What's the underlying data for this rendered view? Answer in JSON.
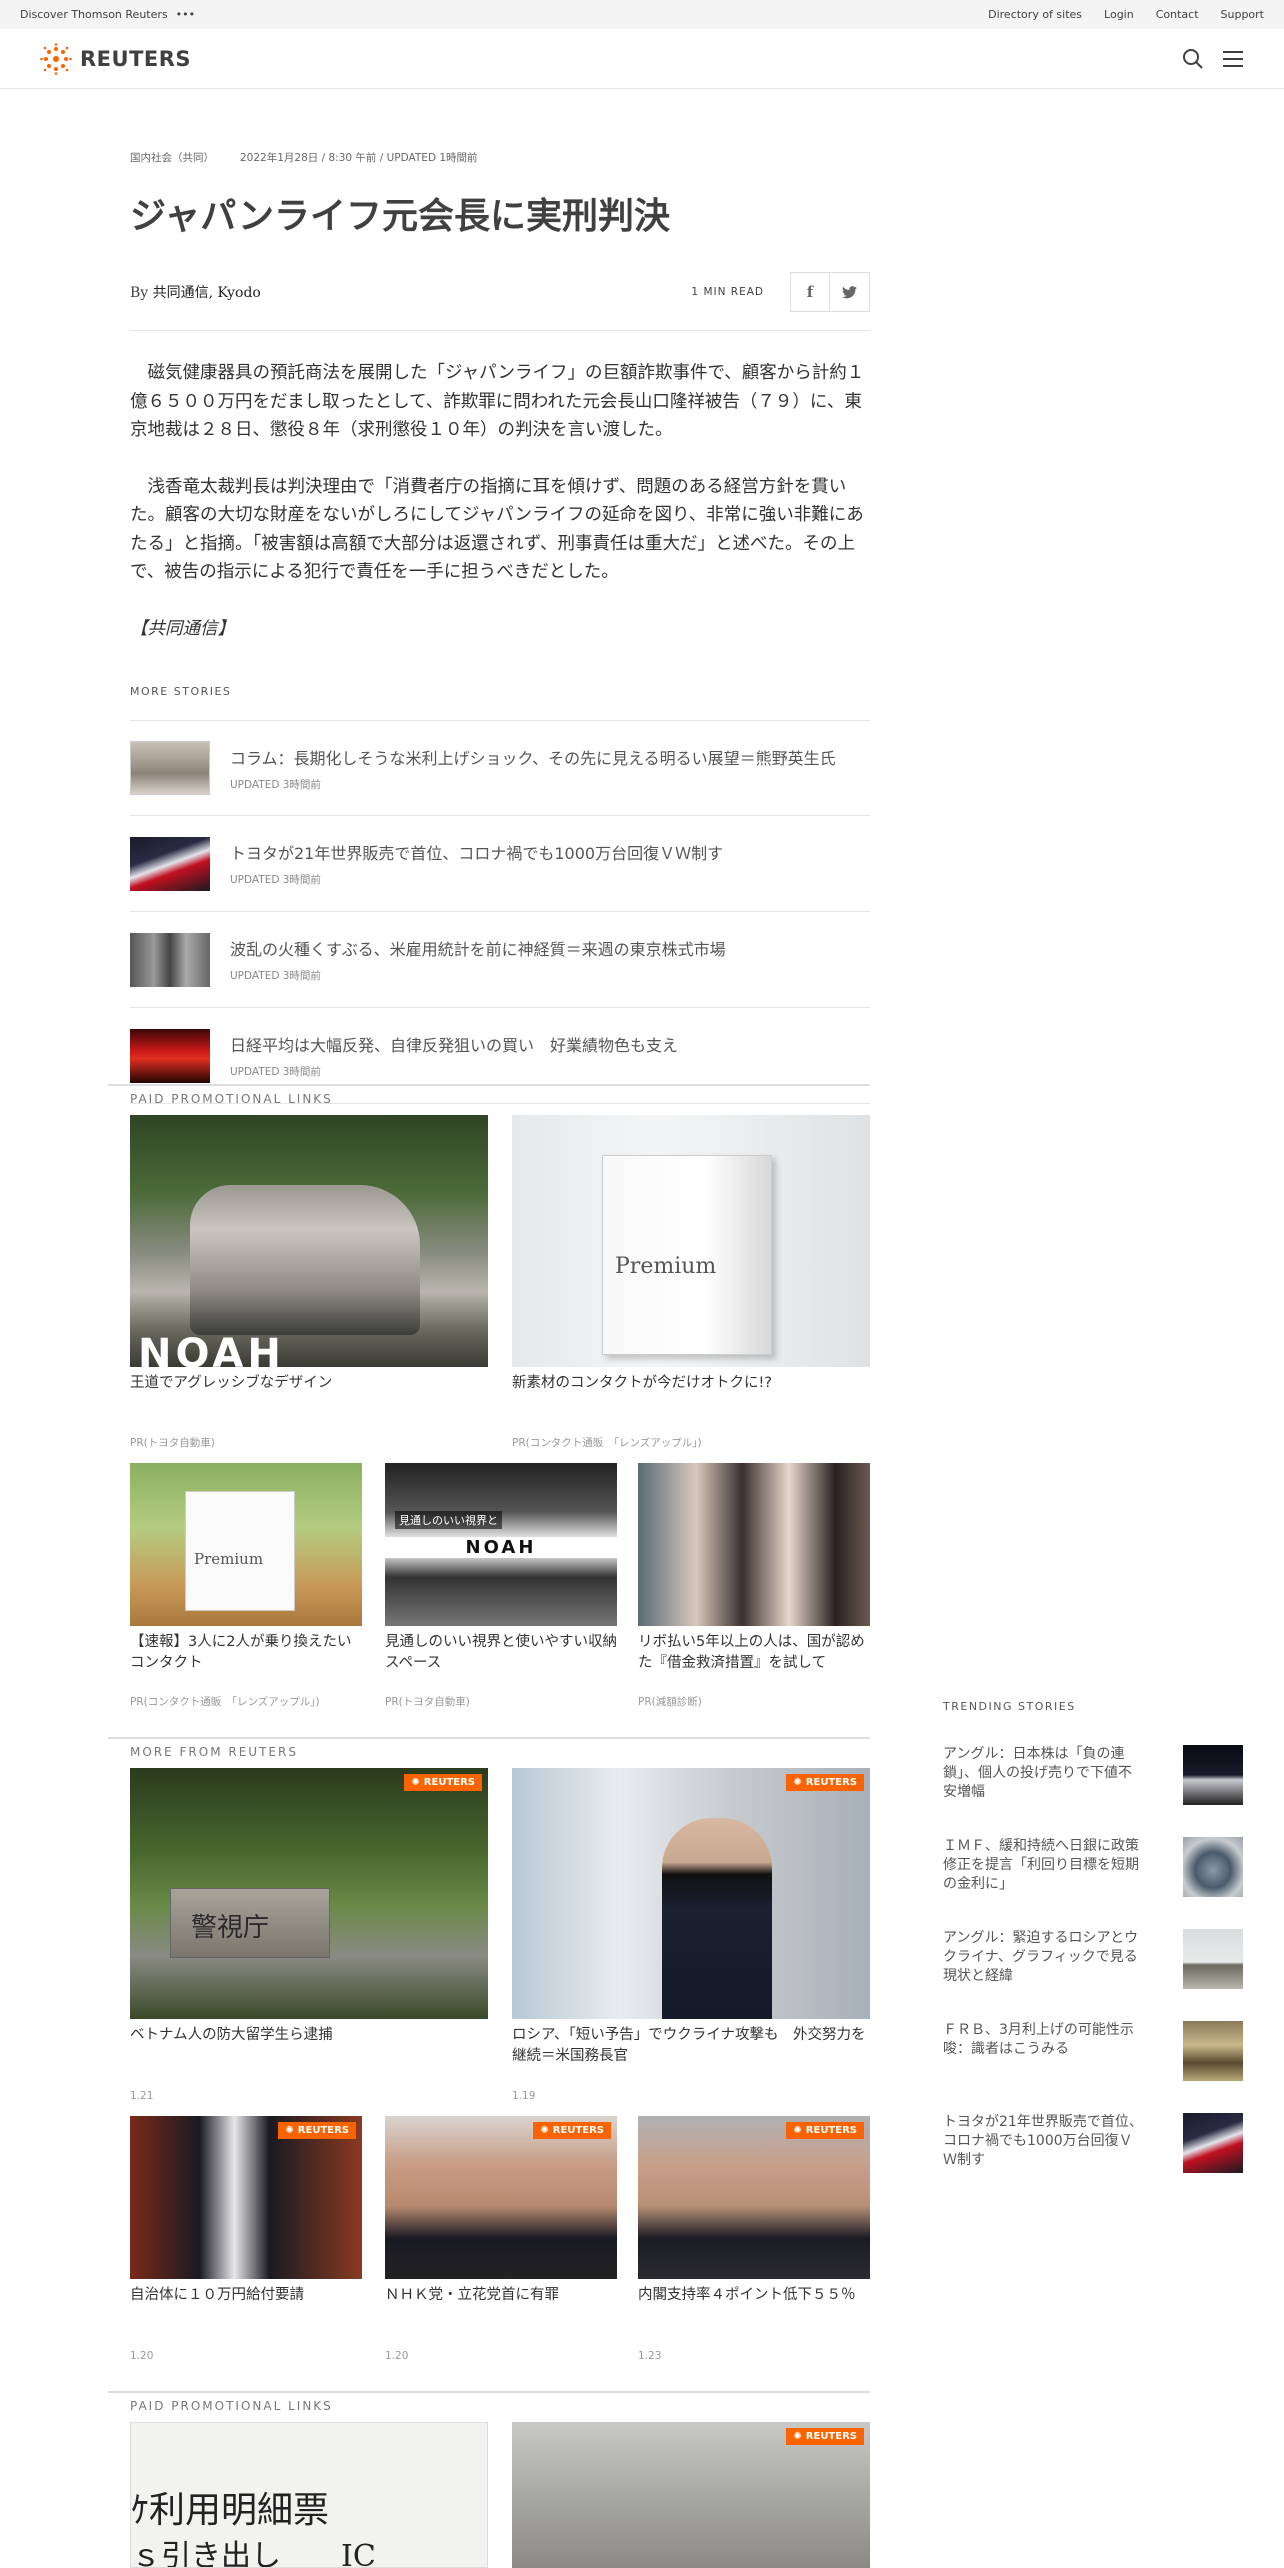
{
  "topbar": {
    "discover": "Discover Thomson Reuters",
    "more": "•••",
    "links": [
      "Directory of sites",
      "Login",
      "Contact",
      "Support"
    ]
  },
  "header": {
    "logo": "REUTERS"
  },
  "article": {
    "section": "国内社会（共同）",
    "timestamp": "2022年1月28日 / 8:30 午前 / UPDATED 1時間前",
    "title": "ジャパンライフ元会長に実刑判決",
    "by": "By",
    "authors": "共同通信, Kyodo",
    "read_time": "1 MIN READ",
    "paragraphs": [
      "磁気健康器具の預託商法を展開した「ジャパンライフ」の巨額詐欺事件で、顧客から計約１億６５００万円をだまし取ったとして、詐欺罪に問われた元会長山口隆祥被告（７９）に、東京地裁は２８日、懲役８年（求刑懲役１０年）の判決を言い渡した。",
      "浅香竜太裁判長は判決理由で「消費者庁の指摘に耳を傾けず、問題のある経営方針を貫いた。顧客の大切な財産をないがしろにしてジャパンライフの延命を図り、非常に強い非難にあたる」と指摘。「被害額は高額で大部分は返還されず、刑事責任は重大だ」と述べた。その上で、被告の指示による犯行で責任を一手に担うべきだとした。"
    ],
    "source": "【共同通信】"
  },
  "more_stories": {
    "heading": "MORE STORIES",
    "items": [
      {
        "title": "コラム：長期化しそうな米利上げショック、その先に見える明るい展望＝熊野英生氏",
        "time": "UPDATED 3時間前"
      },
      {
        "title": "トヨタが21年世界販売で首位、コロナ禍でも1000万台回復ＶＷ制す",
        "time": "UPDATED 3時間前"
      },
      {
        "title": "波乱の火種くすぶる、米雇用統計を前に神経質＝来週の東京株式市場",
        "time": "UPDATED 3時間前"
      },
      {
        "title": "日経平均は大幅反発、自律反発狙いの買い　好業績物色も支え",
        "time": "UPDATED 3時間前"
      }
    ]
  },
  "promo1": {
    "heading": "PAID PROMOTIONAL LINKS",
    "big": [
      {
        "title": "王道でアグレッシブなデザイン",
        "source": "PR(トヨタ自動車)",
        "img_text": "NOAH"
      },
      {
        "title": "新素材のコンタクトが今だけオトクに!?",
        "source": "PR(コンタクト通販　「レンズアップル」)",
        "img_text": "Premium"
      }
    ],
    "small": [
      {
        "title": "【速報】3人に2人が乗り換えたいコンタクト",
        "source": "PR(コンタクト通販　「レンズアップル」)",
        "img_text": "Premium"
      },
      {
        "title": "見通しのいい視界と使いやすい収納スペース",
        "source": "PR(トヨタ自動車)",
        "img_text": "NOAH",
        "img_text2": "見通しのいい視界と"
      },
      {
        "title": "リボ払い5年以上の人は、国が認めた『借金救済措置』を試して",
        "source": "PR(減額診断)"
      }
    ]
  },
  "more_reuters": {
    "heading": "MORE FROM REUTERS",
    "badge": "REUTERS",
    "big": [
      {
        "title": "ベトナム人の防大留学生ら逮捕",
        "date": "1.21",
        "img_text": "警視庁"
      },
      {
        "title": "ロシア、「短い予告」でウクライナ攻撃も　外交努力を継続＝米国務長官",
        "date": "1.19"
      }
    ],
    "small": [
      {
        "title": "自治体に１０万円給付要請",
        "date": "1.20"
      },
      {
        "title": "ＮＨＫ党・立花党首に有罪",
        "date": "1.20"
      },
      {
        "title": "内閣支持率４ポイント低下５５％",
        "date": "1.23"
      }
    ]
  },
  "promo2": {
    "heading": "PAID PROMOTIONAL LINKS",
    "img_text1": "ｹ利用明細票",
    "img_text2": "ｓ引き出し　　IC"
  },
  "trending": {
    "heading": "TRENDING STORIES",
    "items": [
      {
        "title": "アングル：日本株は「負の連鎖」、個人の投げ売りで下値不安増幅"
      },
      {
        "title": "ＩＭＦ、緩和持続へ日銀に政策修正を提言「利回り目標を短期の金利に」"
      },
      {
        "title": "アングル：緊迫するロシアとウクライナ、グラフィックで見る現状と経緯"
      },
      {
        "title": "ＦＲＢ、3月利上げの可能性示唆：識者はこうみる"
      },
      {
        "title": "トヨタが21年世界販売で首位、コロナ禍でも1000万台回復ＶＷ制す"
      }
    ]
  }
}
